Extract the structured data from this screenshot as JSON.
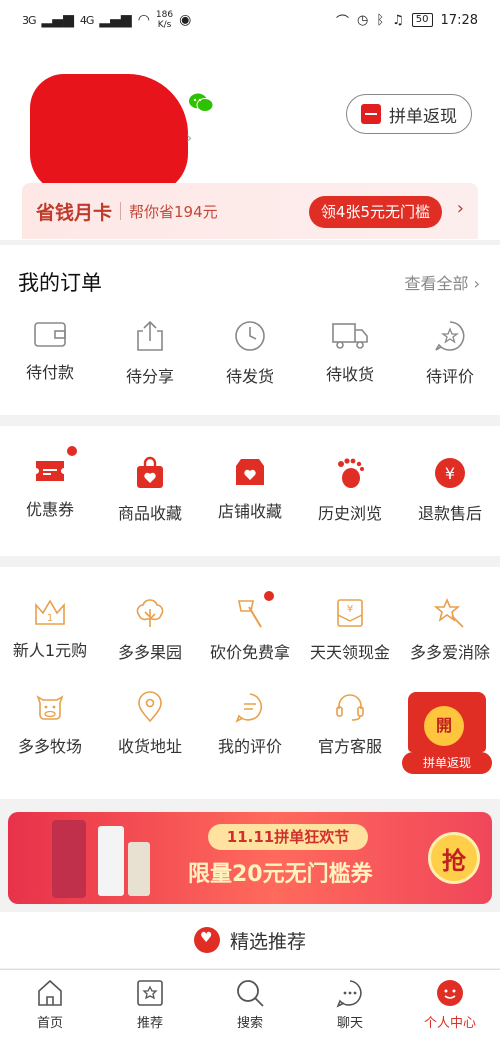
{
  "status_bar": {
    "signal1": "3G",
    "signal2": "4G",
    "net_speed_value": "186",
    "net_speed_unit": "K/s",
    "battery": "50",
    "time": "17:28"
  },
  "profile": {
    "group_button_label": "拼单返现"
  },
  "money_card": {
    "title": "省钱月卡",
    "subtitle": "帮你省194元",
    "button_label": "领4张5元无门槛"
  },
  "orders": {
    "title": "我的订单",
    "view_all": "查看全部",
    "items": [
      {
        "label": "待付款",
        "icon": "wallet-icon"
      },
      {
        "label": "待分享",
        "icon": "share-icon"
      },
      {
        "label": "待发货",
        "icon": "clock-icon"
      },
      {
        "label": "待收货",
        "icon": "truck-icon"
      },
      {
        "label": "待评价",
        "icon": "review-icon"
      }
    ]
  },
  "services": {
    "items": [
      {
        "label": "优惠券",
        "icon": "coupon-icon"
      },
      {
        "label": "商品收藏",
        "icon": "bag-heart-icon"
      },
      {
        "label": "店铺收藏",
        "icon": "shop-heart-icon"
      },
      {
        "label": "历史浏览",
        "icon": "footprint-icon"
      },
      {
        "label": "退款售后",
        "icon": "refund-icon"
      }
    ]
  },
  "grid": {
    "row1": [
      {
        "label": "新人1元购",
        "icon": "crown-icon"
      },
      {
        "label": "多多果园",
        "icon": "tree-icon"
      },
      {
        "label": "砍价免费拿",
        "icon": "axe-icon"
      },
      {
        "label": "天天领现金",
        "icon": "cash-envelope-icon"
      },
      {
        "label": "多多爱消除",
        "icon": "star-wand-icon"
      }
    ],
    "row2": [
      {
        "label": "多多牧场",
        "icon": "cow-icon"
      },
      {
        "label": "收货地址",
        "icon": "location-icon"
      },
      {
        "label": "我的评价",
        "icon": "comment-icon"
      },
      {
        "label": "官方客服",
        "icon": "headset-icon"
      }
    ],
    "float_label": "拼单返现",
    "float_coin": "開"
  },
  "banner": {
    "tag": "11.11拼单狂欢节",
    "main": "限量20元无门槛券",
    "grab": "抢"
  },
  "recommend": {
    "label": "精选推荐"
  },
  "tabbar": {
    "items": [
      {
        "label": "首页",
        "icon": "home-icon"
      },
      {
        "label": "推荐",
        "icon": "recommend-icon"
      },
      {
        "label": "搜索",
        "icon": "search-icon"
      },
      {
        "label": "聊天",
        "icon": "chat-icon"
      },
      {
        "label": "个人中心",
        "icon": "profile-icon"
      }
    ]
  },
  "colors": {
    "brand_red": "#e02e24",
    "orange_icon": "#e8a04a",
    "grey_icon": "#888888"
  }
}
